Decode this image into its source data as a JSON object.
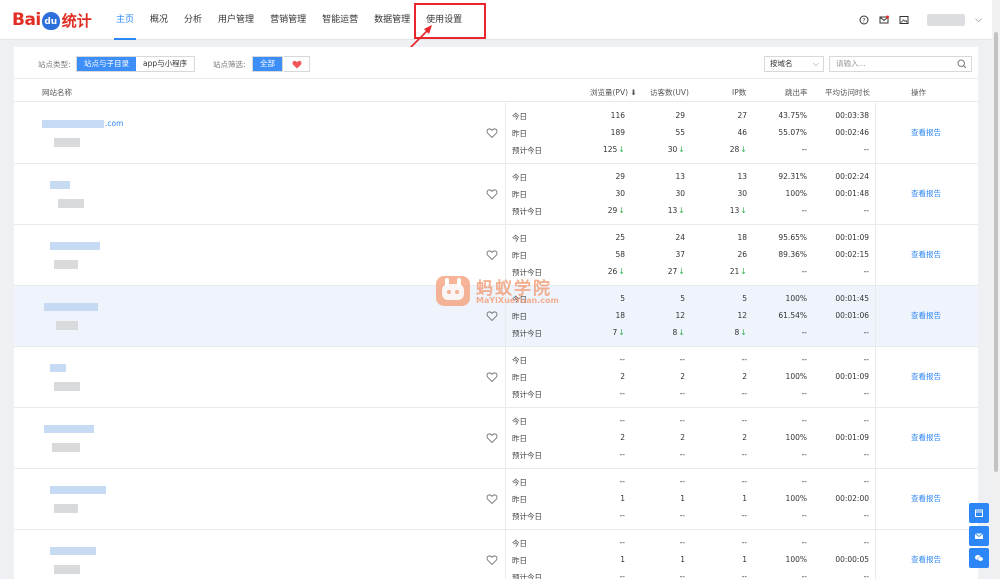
{
  "brand": {
    "text": "Bai",
    "paw": "du",
    "suffix": "统计",
    "brand_color": "#e02e24"
  },
  "nav": [
    {
      "label": "主页",
      "active": true
    },
    {
      "label": "概况"
    },
    {
      "label": "分析"
    },
    {
      "label": "用户管理"
    },
    {
      "label": "营销管理"
    },
    {
      "label": "智能运营"
    },
    {
      "label": "数据管理"
    },
    {
      "label": "使用设置"
    }
  ],
  "filter": {
    "type_label": "站点类型:",
    "type_options": [
      "站点与子目录",
      "app与小程序"
    ],
    "filter_label": "站点筛选:",
    "filter_all": "全部",
    "domain_select": "按域名",
    "search_placeholder": "请输入..."
  },
  "table": {
    "headers": {
      "site": "网站名称",
      "pv": "浏览量(PV)",
      "uv": "访客数(UV)",
      "ip": "IP数",
      "bounce": "跳出率",
      "avg": "平均访问时长",
      "op": "操作"
    },
    "period_labels": [
      "今日",
      "昨日",
      "预计今日"
    ],
    "report_label": "查看报告",
    "rows": [
      {
        "domain_suffix": ".com",
        "stats": [
          [
            "116",
            "29",
            "27",
            "43.75%",
            "00:03:38"
          ],
          [
            "189",
            "55",
            "46",
            "55.07%",
            "00:02:46"
          ],
          [
            "125",
            "30",
            "28",
            "--",
            "--"
          ]
        ]
      },
      {
        "domain_suffix": "",
        "stats": [
          [
            "29",
            "13",
            "13",
            "92.31%",
            "00:02:24"
          ],
          [
            "30",
            "30",
            "30",
            "100%",
            "00:01:48"
          ],
          [
            "29",
            "13",
            "13",
            "--",
            "--"
          ]
        ]
      },
      {
        "domain_suffix": "",
        "stats": [
          [
            "25",
            "24",
            "18",
            "95.65%",
            "00:01:09"
          ],
          [
            "58",
            "37",
            "26",
            "89.36%",
            "00:02:15"
          ],
          [
            "26",
            "27",
            "21",
            "--",
            "--"
          ]
        ]
      },
      {
        "domain_suffix": "",
        "stats": [
          [
            "5",
            "5",
            "5",
            "100%",
            "00:01:45"
          ],
          [
            "18",
            "12",
            "12",
            "61.54%",
            "00:01:06"
          ],
          [
            "7",
            "8",
            "8",
            "--",
            "--"
          ]
        ]
      },
      {
        "domain_suffix": "",
        "stats": [
          [
            "--",
            "--",
            "--",
            "--",
            "--"
          ],
          [
            "2",
            "2",
            "2",
            "100%",
            "00:01:09"
          ],
          [
            "--",
            "--",
            "--",
            "--",
            "--"
          ]
        ]
      },
      {
        "domain_suffix": "",
        "stats": [
          [
            "--",
            "--",
            "--",
            "--",
            "--"
          ],
          [
            "2",
            "2",
            "2",
            "100%",
            "00:01:09"
          ],
          [
            "--",
            "--",
            "--",
            "--",
            "--"
          ]
        ]
      },
      {
        "domain_suffix": "",
        "stats": [
          [
            "--",
            "--",
            "--",
            "--",
            "--"
          ],
          [
            "1",
            "1",
            "1",
            "100%",
            "00:02:00"
          ],
          [
            "--",
            "--",
            "--",
            "--",
            "--"
          ]
        ]
      },
      {
        "domain_suffix": "",
        "stats": [
          [
            "--",
            "--",
            "--",
            "--",
            "--"
          ],
          [
            "1",
            "1",
            "1",
            "100%",
            "00:00:05"
          ],
          [
            "--",
            "--",
            "--",
            "--",
            "--"
          ]
        ]
      }
    ]
  },
  "watermark": {
    "title": "蚂蚁学院",
    "url": "MaYiXueYuan.com"
  },
  "colors": {
    "accent": "#2d86f5",
    "down_arrow": "#3bb55a",
    "highlight": "#e8262c"
  }
}
